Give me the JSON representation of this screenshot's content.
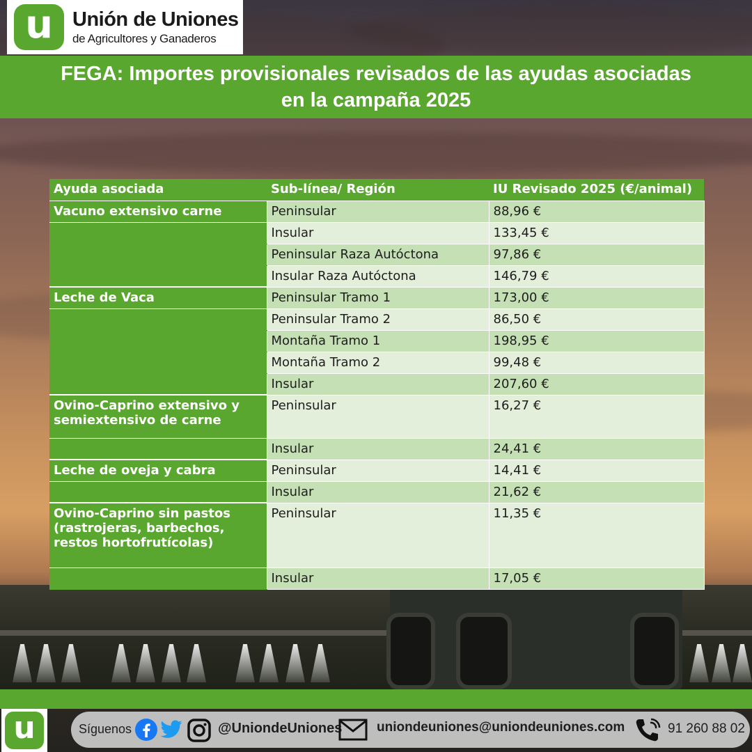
{
  "header": {
    "logo_letter": "u",
    "logo_title": "Unión de Uniones",
    "logo_subtitle": "de Agricultores y Ganaderos",
    "title": "FEGA: Importes provisionales revisados de las ayudas asociadas en la campaña 2025"
  },
  "table": {
    "columns": [
      "Ayuda asociada",
      "Sub-línea/ Región",
      "IU Revisado 2025 (€/animal)"
    ],
    "rows": [
      {
        "category": "Vacuno extensivo carne",
        "subline": "Peninsular",
        "value": "88,96 €"
      },
      {
        "category": "",
        "subline": "Insular",
        "value": "133,45 €"
      },
      {
        "category": "",
        "subline": "Peninsular Raza Autóctona",
        "value": "97,86 €"
      },
      {
        "category": "",
        "subline": "Insular Raza Autóctona",
        "value": "146,79 €"
      },
      {
        "category": "Leche de Vaca",
        "subline": "Peninsular Tramo 1",
        "value": "173,00 €"
      },
      {
        "category": "",
        "subline": "Peninsular Tramo 2",
        "value": "86,50 €"
      },
      {
        "category": "",
        "subline": "Montaña Tramo 1",
        "value": "198,95 €"
      },
      {
        "category": "",
        "subline": "Montaña Tramo 2",
        "value": "99,48 €"
      },
      {
        "category": "",
        "subline": "Insular",
        "value": "207,60 €"
      },
      {
        "category": "Ovino-Caprino extensivo y semiextensivo de carne",
        "subline": "Peninsular",
        "value": "16,27 €"
      },
      {
        "category": "",
        "subline": "Insular",
        "value": "24,41 €"
      },
      {
        "category": "Leche de oveja y cabra",
        "subline": "Peninsular",
        "value": "14,41 €"
      },
      {
        "category": "",
        "subline": "Insular",
        "value": "21,62 €"
      },
      {
        "category": "Ovino-Caprino sin pastos (rastrojeras, barbechos, restos hortofrutícolas)",
        "subline": "Peninsular",
        "value": "11,35 €"
      },
      {
        "category": "",
        "subline": "Insular",
        "value": "17,05 €"
      }
    ]
  },
  "footer": {
    "logo_letter": "u",
    "follow_label": "Síguenos",
    "social_icons": [
      "facebook-icon",
      "twitter-icon",
      "instagram-icon"
    ],
    "handle": "@UniondeUniones",
    "email": "uniondeuniones@uniondeuniones.com",
    "phone": "91 260 88 02"
  },
  "colors": {
    "brand_green": "#5aa72f",
    "row_light": "#e3efda",
    "row_mid": "#c5e0b4"
  }
}
